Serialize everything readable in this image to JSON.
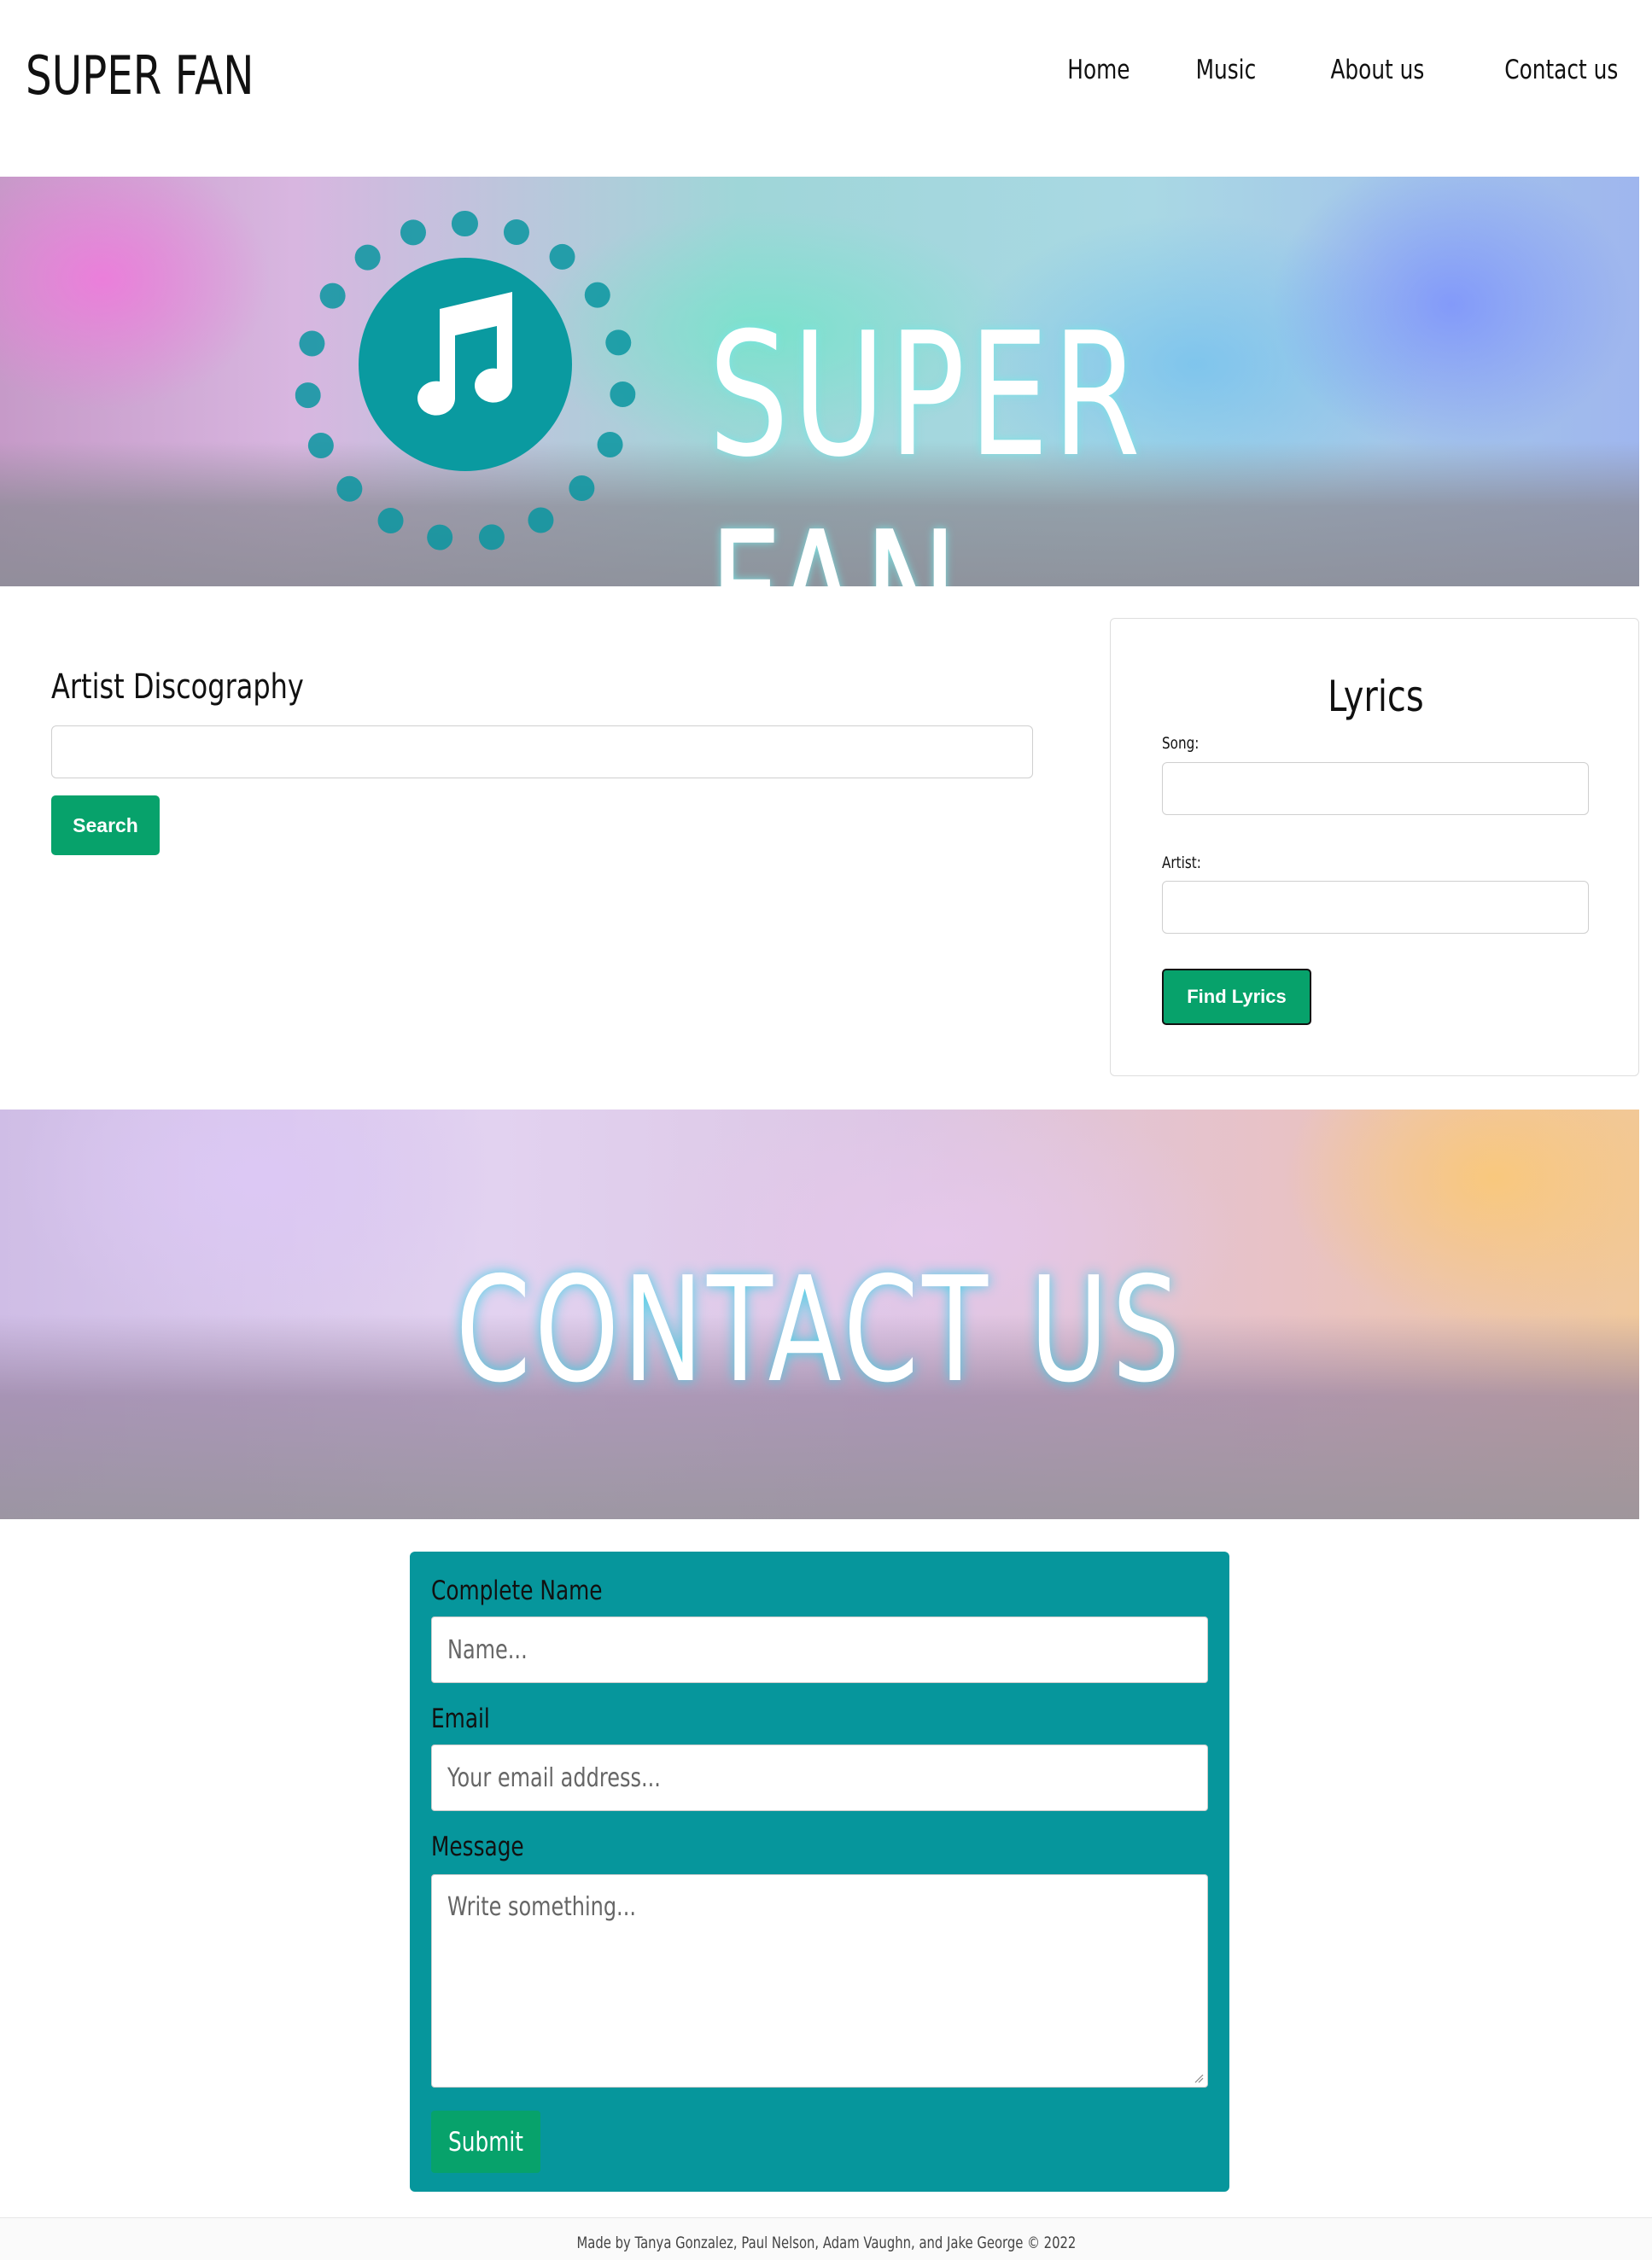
{
  "header": {
    "brand": "SUPER FAN",
    "nav": [
      {
        "label": "Home"
      },
      {
        "label": "Music"
      },
      {
        "label": "About us"
      },
      {
        "label": "Contact us"
      }
    ]
  },
  "hero": {
    "title": "SUPER FAN",
    "logo_icon": "music-note-icon"
  },
  "discography": {
    "title": "Artist Discography",
    "search_value": "",
    "search_button": "Search"
  },
  "lyrics": {
    "title": "Lyrics",
    "song_label": "Song:",
    "song_value": "",
    "artist_label": "Artist:",
    "artist_value": "",
    "button": "Find Lyrics"
  },
  "contact_banner": {
    "title": "CONTACT US"
  },
  "contact_form": {
    "name_label": "Complete Name",
    "name_placeholder": "Name...",
    "email_label": "Email",
    "email_placeholder": "Your email address...",
    "message_label": "Message",
    "message_placeholder": "Write something...",
    "submit": "Submit"
  },
  "footer": {
    "text": "Made by Tanya Gonzalez, Paul Nelson, Adam Vaughn, and Jake George © 2022"
  },
  "colors": {
    "accent_green": "#07a26b",
    "teal_panel": "#06969c"
  }
}
